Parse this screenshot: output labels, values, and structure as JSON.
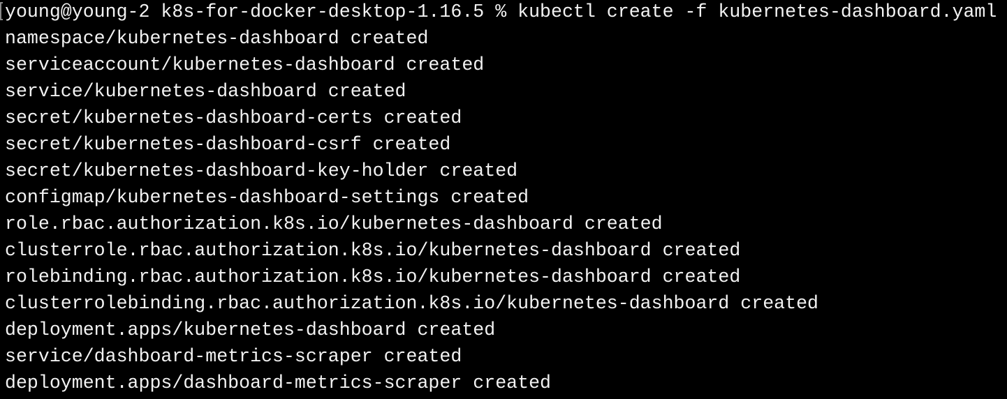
{
  "prompt": "young@young-2 k8s-for-docker-desktop-1.16.5 % kubectl create -f kubernetes-dashboard.yaml",
  "output": [
    "namespace/kubernetes-dashboard created",
    "serviceaccount/kubernetes-dashboard created",
    "service/kubernetes-dashboard created",
    "secret/kubernetes-dashboard-certs created",
    "secret/kubernetes-dashboard-csrf created",
    "secret/kubernetes-dashboard-key-holder created",
    "configmap/kubernetes-dashboard-settings created",
    "role.rbac.authorization.k8s.io/kubernetes-dashboard created",
    "clusterrole.rbac.authorization.k8s.io/kubernetes-dashboard created",
    "rolebinding.rbac.authorization.k8s.io/kubernetes-dashboard created",
    "clusterrolebinding.rbac.authorization.k8s.io/kubernetes-dashboard created",
    "deployment.apps/kubernetes-dashboard created",
    "service/dashboard-metrics-scraper created",
    "deployment.apps/dashboard-metrics-scraper created"
  ]
}
